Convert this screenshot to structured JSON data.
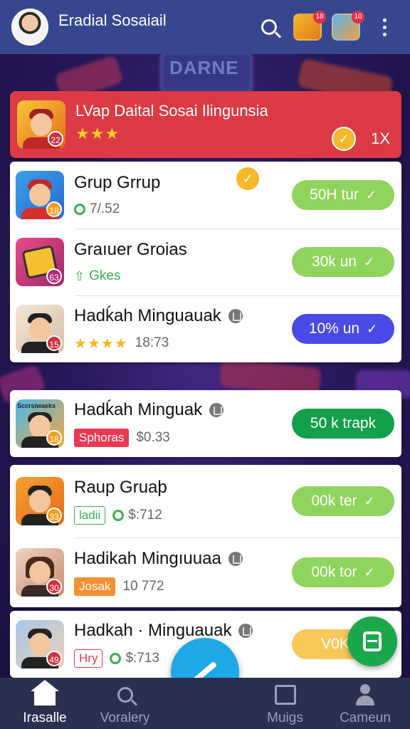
{
  "app": {
    "title": "Eradial Sosaiail"
  },
  "header": {
    "badge_1": "18",
    "badge_2": "10"
  },
  "featured": {
    "title": "LVap Daital Sosai Ilingunsia",
    "stars": "★★★",
    "level": "22",
    "count": "1X"
  },
  "card1": [
    {
      "name": "Grup Grrup",
      "meta": "7/.52",
      "level": "18",
      "button": "50H tur"
    },
    {
      "name": "Graıuer Groias",
      "meta": "Gkes",
      "level": "63",
      "button": "30k un"
    },
    {
      "name": "Hadḱah Minguauak",
      "stars": "★★★★",
      "meta": "18:73",
      "level": "15",
      "button": "10% un"
    }
  ],
  "card2": {
    "name": "Hadḱah Minguak",
    "tag": "Sphoras",
    "meta": "$0.33",
    "level": "18",
    "thumb_text": "Sccrsiwaeks",
    "button": "50 k trapk"
  },
  "card3": [
    {
      "name": "Raup Gruaþ",
      "tag": "ladii",
      "meta": "$:712",
      "level": "33",
      "button": "00k ter"
    },
    {
      "name": "Hadikah Mingıuuaa",
      "tag": "Josak",
      "meta": "10 772",
      "level": "30",
      "button": "00k tor"
    }
  ],
  "card4": {
    "name": "Hadkah · Minguauak",
    "tag": "Hry",
    "meta": "$:713",
    "level": "49",
    "button": "V0K lo"
  },
  "background": {
    "sign_text": "DARNE"
  },
  "nav": [
    {
      "label": "Irasalle"
    },
    {
      "label": "Voralery"
    },
    {
      "label": "Muigs"
    },
    {
      "label": "Cameun"
    }
  ],
  "colors": {
    "header": "#37478f",
    "featured": "#dc3a45",
    "btn_lime": "#8fd45c",
    "btn_indigo": "#4a4ae6",
    "btn_green": "#12a048",
    "fab": "#1ea8e8"
  }
}
